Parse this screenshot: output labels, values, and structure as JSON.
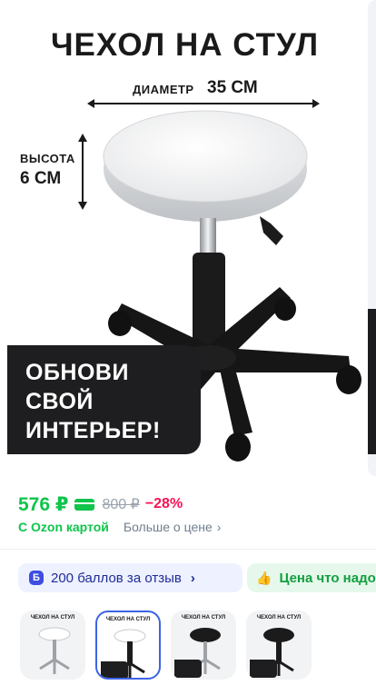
{
  "hero": {
    "title": "ЧЕХОЛ НА СТУЛ",
    "diameter_label": "ДИАМЕТР",
    "diameter_value": "35 СМ",
    "height_label": "ВЫСОТА",
    "height_value": "6 СМ",
    "promo_lines": [
      "ОБНОВИ",
      "СВОЙ",
      "ИНТЕРЬЕР!"
    ]
  },
  "price": {
    "current": "576 ₽",
    "old": "800 ₽",
    "discount": "−28%",
    "ozon_card": "С Ozon картой",
    "more": "Больше о цене"
  },
  "chips": {
    "bonus_icon": "Б",
    "bonus_text": "200 баллов за отзыв",
    "guarantee_text": "Цена что надо"
  },
  "thumbnails": [
    {
      "title": "ЧЕХОЛ НА СТУЛ",
      "seat": "white-seat"
    },
    {
      "title": "ЧЕХОЛ НА СТУЛ",
      "seat": "white-seat",
      "active": true
    },
    {
      "title": "ЧЕХОЛ НА СТУЛ",
      "seat": "black-seat"
    },
    {
      "title": "ЧЕХОЛ НА СТУЛ",
      "seat": "black-seat"
    }
  ],
  "colors": {
    "price_green": "#10c44c",
    "discount_red": "#f91155",
    "bonus_blue": "#3d4de0",
    "active_border": "#3d63e6"
  }
}
